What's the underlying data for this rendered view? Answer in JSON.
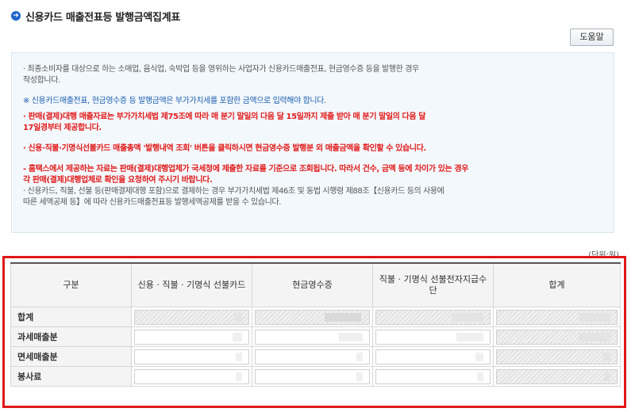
{
  "header": {
    "title": "신용카드 매출전표등 발행금액집계표",
    "help_label": "도움말"
  },
  "notice": [
    {
      "style": "gray",
      "text": "· 최종소비자를 대상으로 하는 소매업, 음식업, 숙박업 등을 영위하는 사업자가 신용카드매출전표, 현금영수증 등을 발행한 경우"
    },
    {
      "style": "gray",
      "text": "   작성합니다."
    },
    {
      "style": "blue",
      "text": "※ 신용카드매출전표, 현금영수증 등 발행금액은 부가가치세를 포함한 금액으로 입력해야 합니다."
    },
    {
      "style": "red",
      "text": "· 판매(결제)대행 매출자료는 부가가치세법 제75조에 따라 매 분기 말일의 다음 달 15일까지 제출 받아 매 분기 말일의 다음 달"
    },
    {
      "style": "red",
      "text": "   17일경부터 제공합니다."
    },
    {
      "style": "red",
      "text": "· 신용·직불·기명식선불카드 매출총액 '발행내역 조회' 버튼을 클릭하시면 현금영수증 발행분 외 매출금액을 확인할 수 있습니다."
    },
    {
      "style": "red",
      "text": "- 홈택스에서 제공하는 자료는 판매(결제)대행업체가 국세청에 제출한 자료를 기준으로 조회됩니다. 따라서 건수, 금액 등에 차이가  있는 경우"
    },
    {
      "style": "red",
      "text": "   각 판매(결제)대행업체로 확인을 요청하여 주시기 바랍니다."
    },
    {
      "style": "gray",
      "text": "· 신용카드, 직불, 선불 등(판매결제대행 포함)으로 결제하는 경우 부가가치세법 제46조 및 동법 시행령 제88조【신용카드 등의 사용에"
    },
    {
      "style": "gray",
      "text": "   따른 세액공제 등】에 따라  신용카드매출전표등 발행세액공제를 받을 수 있습니다."
    }
  ],
  "unit_label": "(단위:원)",
  "table": {
    "headers": [
      "구분",
      "신용 · 직불 · 기명식 선불카드",
      "현금영수증",
      "직불 · 기명식 선불전자지급수단",
      "합계"
    ],
    "rows": [
      {
        "label": "합계"
      },
      {
        "label": "과세매출분"
      },
      {
        "label": "면세매출분"
      },
      {
        "label": "봉사료"
      }
    ]
  }
}
